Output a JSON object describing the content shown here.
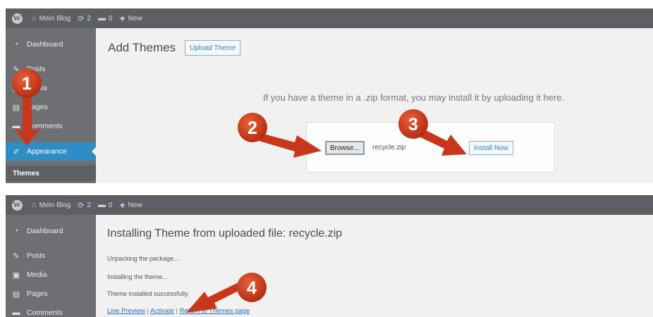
{
  "admin_bar": {
    "site_name": "Mein Blog",
    "updates_count": "2",
    "comments_count": "0",
    "new_label": "New"
  },
  "sidebar": {
    "dashboard": "Dashboard",
    "posts": "Posts",
    "media": "Media",
    "pages": "Pages",
    "comments": "Comments",
    "appearance": "Appearance",
    "themes": "Themes"
  },
  "add_themes": {
    "title": "Add Themes",
    "upload_button": "Upload Theme",
    "help_text": "If you have a theme in a .zip format, you may install it by uploading it here.",
    "browse_button": "Browse...",
    "file_name": "recycle.zip",
    "install_button": "Install Now"
  },
  "install_result": {
    "title": "Installing Theme from uploaded file: recycle.zip",
    "line1": "Unpacking the package...",
    "line2": "Installing the theme...",
    "line3": "Theme installed successfully.",
    "live_preview": "Live Preview",
    "activate": "Activate",
    "return_link": "Return to Themes page"
  },
  "callouts": {
    "step1": "1",
    "step2": "2",
    "step3": "3",
    "step4": "4"
  },
  "colors": {
    "admin_bar": "#5c5f63",
    "sidebar": "#6d6f72",
    "active_menu": "#2e8dc5",
    "callout_red": "#cc3a1a"
  }
}
